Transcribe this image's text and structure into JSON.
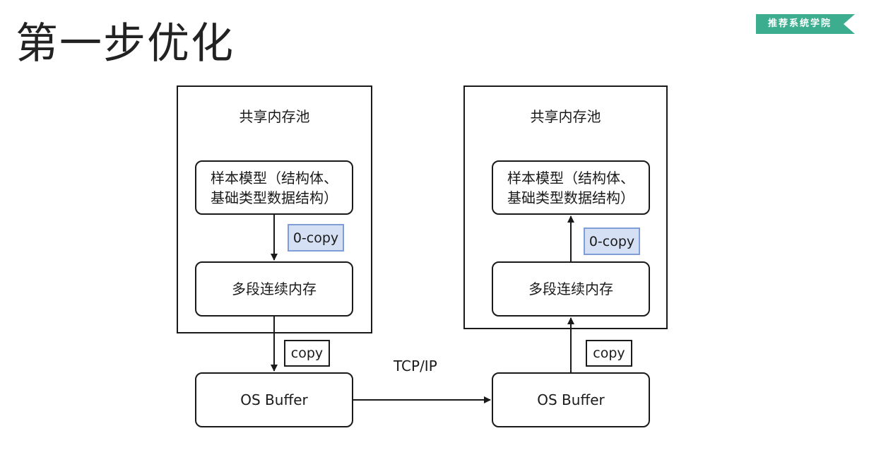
{
  "slide": {
    "title": "第一步优化",
    "brand": "推荐系统学院"
  },
  "colors": {
    "brand_green": "#3cad8f",
    "zero_copy_fill": "#d6e0f5",
    "zero_copy_border": "#7f9ed8",
    "line": "#1a1a1a"
  },
  "diagram": {
    "left": {
      "pool_label": "共享内存池",
      "model_line1": "样本模型（结构体、",
      "model_line2": "基础类型数据结构）",
      "zero_copy_label": "0-copy",
      "memory_label": "多段连续内存",
      "copy_label": "copy",
      "buffer_label": "OS Buffer"
    },
    "right": {
      "pool_label": "共享内存池",
      "model_line1": "样本模型（结构体、",
      "model_line2": "基础类型数据结构）",
      "zero_copy_label": "0-copy",
      "memory_label": "多段连续内存",
      "copy_label": "copy",
      "buffer_label": "OS Buffer"
    },
    "transport_label": "TCP/IP"
  }
}
